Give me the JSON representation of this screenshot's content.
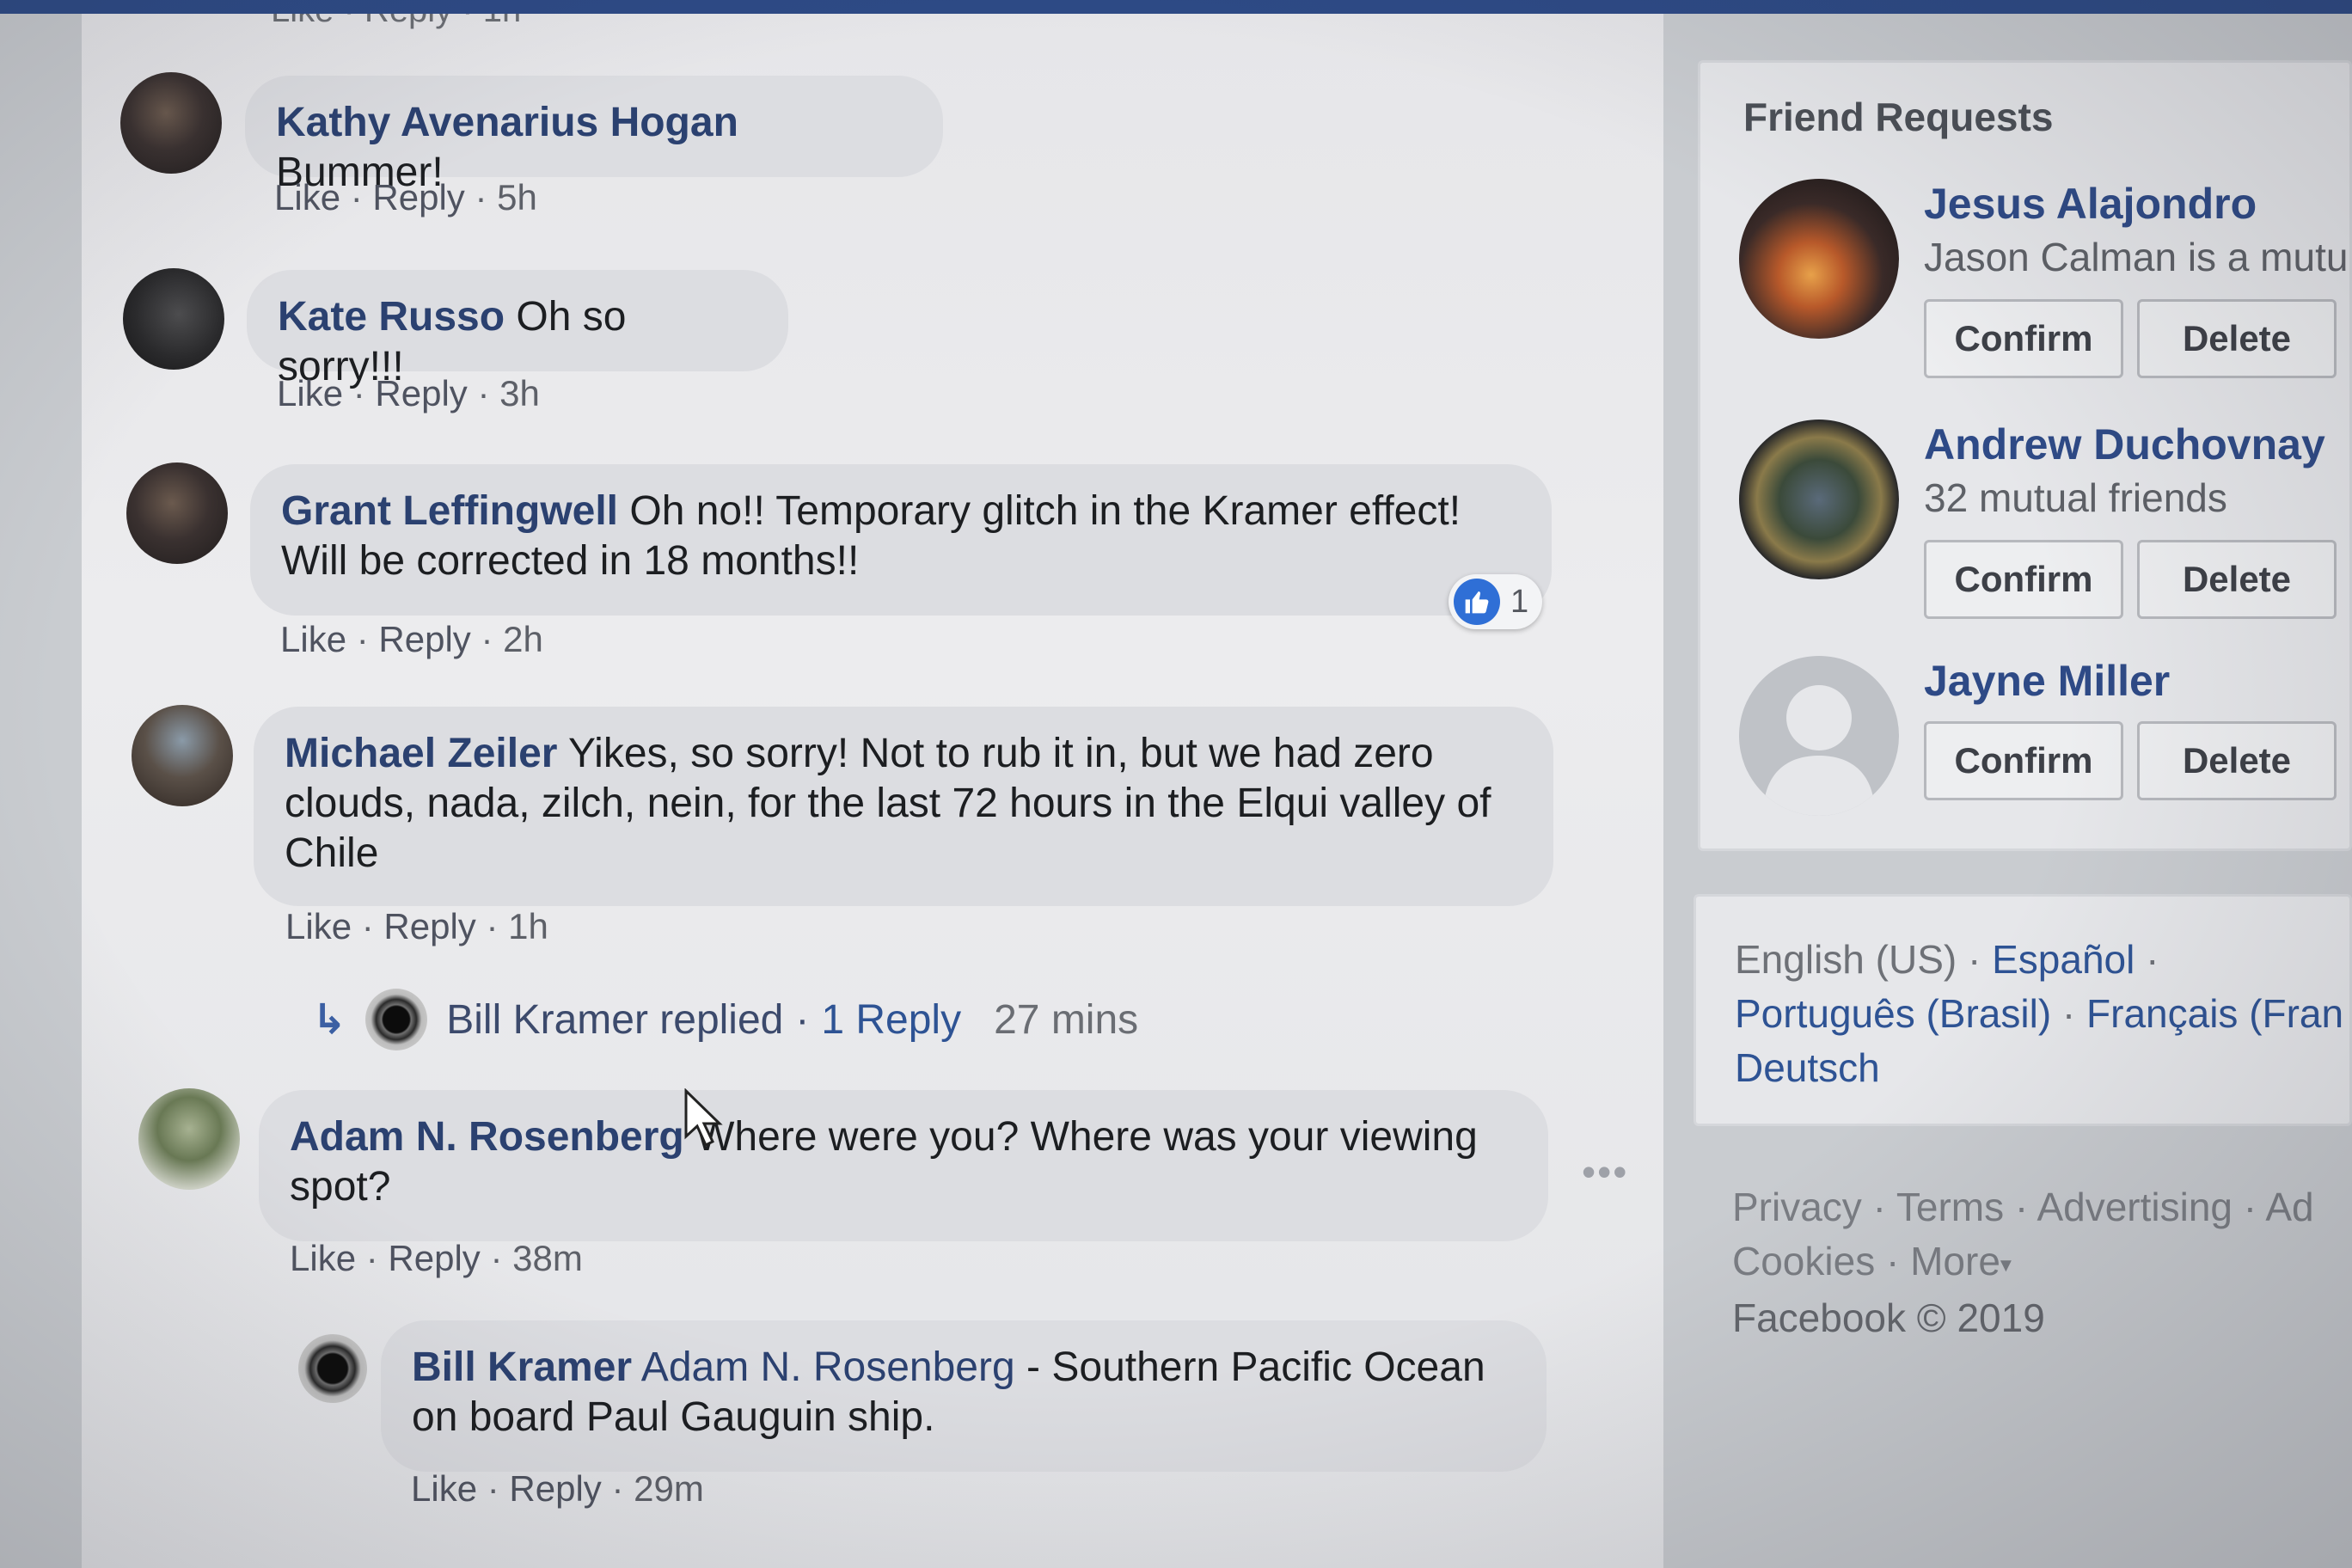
{
  "partial_actions": "Like · Reply · 1h",
  "comments": [
    {
      "author": "Kathy Avenarius Hogan",
      "text": "Bummer!",
      "like": "Like",
      "reply": "Reply",
      "time": "5h"
    },
    {
      "author": "Kate Russo",
      "text": "Oh so sorry!!!",
      "like": "Like",
      "reply": "Reply",
      "time": "3h"
    },
    {
      "author": "Grant Leffingwell",
      "text": "Oh no!! Temporary glitch in the Kramer effect! Will be corrected in 18 months!!",
      "like": "Like",
      "reply": "Reply",
      "time": "2h",
      "reaction_count": "1"
    },
    {
      "author": "Michael Zeiler",
      "text": "Yikes, so sorry! Not to rub it in, but we had zero clouds, nada, zilch, nein, for the last 72 hours in the Elqui valley of Chile",
      "like": "Like",
      "reply": "Reply",
      "time": "1h",
      "replied": {
        "name_text": "Bill Kramer replied",
        "sep": "·",
        "count_text": "1 Reply",
        "time": "27 mins"
      }
    },
    {
      "author": "Adam N. Rosenberg",
      "text": "Where were you? Where was your viewing spot?",
      "like": "Like",
      "reply": "Reply",
      "time": "38m"
    }
  ],
  "reply": {
    "author": "Bill Kramer",
    "mention": "Adam N. Rosenberg",
    "text": "- Southern Pacific Ocean on board Paul Gauguin ship.",
    "like": "Like",
    "reply": "Reply",
    "time": "29m"
  },
  "sidebar": {
    "friend_requests": {
      "title": "Friend Requests",
      "items": [
        {
          "name": "Jesus Alajondro",
          "sub": "Jason Calman is a mutu",
          "confirm": "Confirm",
          "delete": "Delete"
        },
        {
          "name": "Andrew Duchovnay",
          "sub": "32 mutual friends",
          "confirm": "Confirm",
          "delete": "Delete"
        },
        {
          "name": "Jayne Miller",
          "sub": "",
          "confirm": "Confirm",
          "delete": "Delete"
        }
      ]
    },
    "languages": {
      "english": "English (US)",
      "espanol": "Español",
      "portugues": "Português (Brasil)",
      "francais": "Français (Fran",
      "deutsch": "Deutsch"
    },
    "footer": {
      "privacy": "Privacy",
      "terms": "Terms",
      "advertising": "Advertising",
      "ad": "Ad",
      "cookies": "Cookies",
      "more": "More",
      "copyright": "Facebook © 2019"
    }
  },
  "colors": {
    "author": "#2b4170",
    "link": "#2e5394",
    "like_blue": "#2f6fd6",
    "topbar": "#2d4a86"
  }
}
